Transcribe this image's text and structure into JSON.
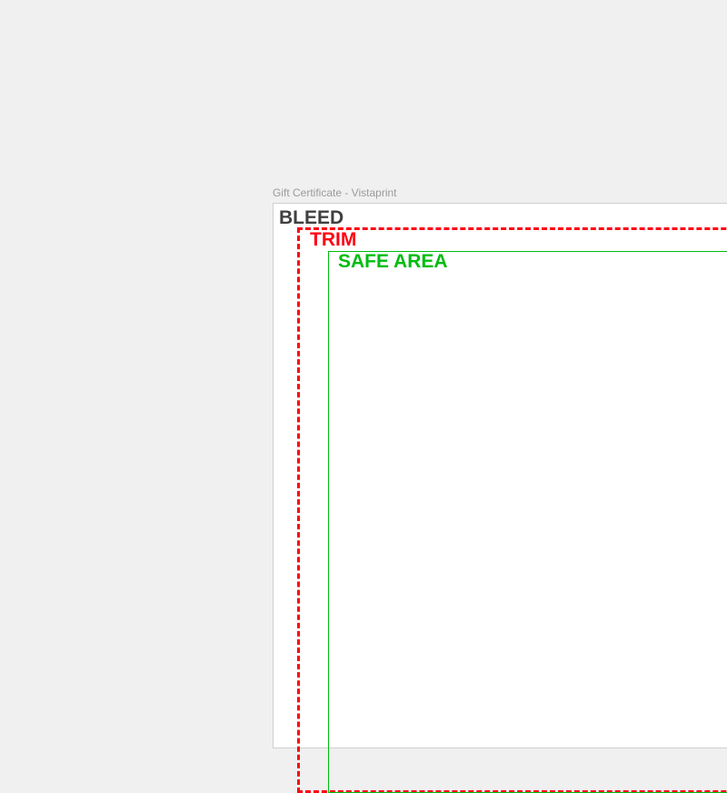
{
  "window": {
    "title": "Gift Certificate - Vistaprint"
  },
  "guides": {
    "bleed": {
      "label": "BLEED",
      "color": "#404040"
    },
    "trim": {
      "label": "TRIM",
      "color": "#ff0014"
    },
    "safe": {
      "label": "SAFE AREA",
      "color": "#00bc0f"
    }
  }
}
